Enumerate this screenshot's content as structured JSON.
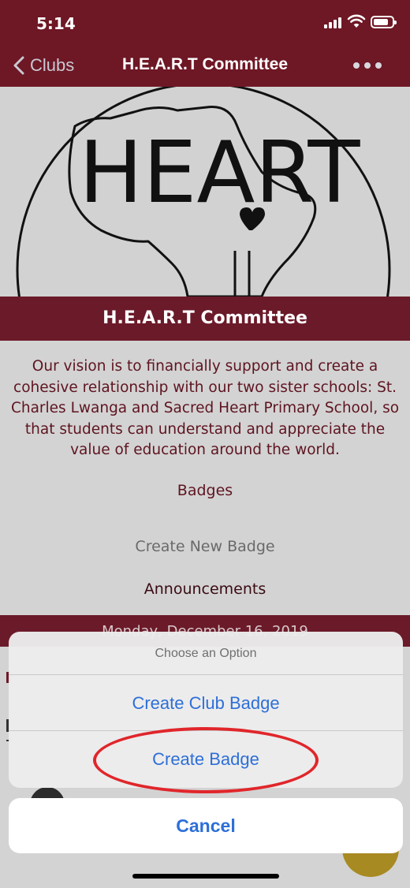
{
  "status_bar": {
    "time": "5:14"
  },
  "nav": {
    "back_label": "Clubs",
    "title": "H.E.A.R.T Committee"
  },
  "club": {
    "logo_text": "HEART",
    "banner_title": "H.E.A.R.T Committee",
    "description": "Our vision is to financially support and create a cohesive relationship with our two sister schools: St. Charles Lwanga and Sacred Heart Primary School, so that students can understand and appreciate the value of education around the world.",
    "badges_heading": "Badges",
    "create_new_badge": "Create New Badge",
    "announcements_heading": "Announcements",
    "announcement_date": "Monday, December 16, 2019"
  },
  "action_sheet": {
    "title": "Choose an Option",
    "options": [
      "Create Club Badge",
      "Create Badge"
    ],
    "cancel_label": "Cancel"
  },
  "colors": {
    "brand": "#6e1725",
    "ios_blue": "#2d6fd8",
    "highlight": "#e0262b",
    "fab": "#a88a22"
  }
}
